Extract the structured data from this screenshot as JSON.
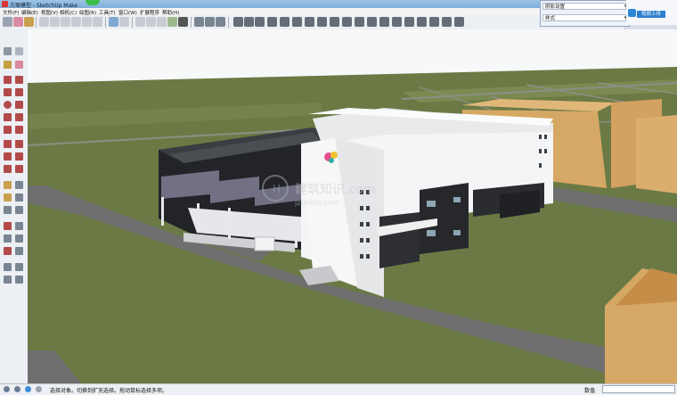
{
  "window": {
    "title": "方案模型 - SketchUp Make"
  },
  "menu": {
    "items": [
      "文件(F)",
      "编辑(E)",
      "视图(V)",
      "相机(C)",
      "绘图(R)",
      "工具(T)",
      "窗口(W)",
      "扩展程序",
      "帮助(H)"
    ]
  },
  "toolbar": {
    "items": [
      "select-tool",
      "eraser-tool",
      "paint-tool",
      "home-view",
      "iso-view",
      "top-view",
      "front-view",
      "right-view",
      "back-view",
      "left-view",
      "xray-style",
      "backedges-style",
      "wireframe-style",
      "hiddenline-style",
      "shaded-style",
      "textured-style",
      "monochrome-style",
      "section-plane",
      "display-sections",
      "section-cuts",
      "fog",
      "lightbulb",
      "camera-position",
      "look-around",
      "walk",
      "tape-measure",
      "protractor",
      "axes",
      "dimensions",
      "text",
      "3d-text",
      "shadows",
      "sandbox",
      "solid-tools",
      "components",
      "materials",
      "styles",
      "layers"
    ]
  },
  "tray": {
    "row1": "阴影设置",
    "row2": "样式"
  },
  "share": {
    "label": "视频上传"
  },
  "status": {
    "message": "选择对象。切换到扩充选择。拖动鼠标选择多项。",
    "measure_label": "数值",
    "measure_value": ""
  },
  "watermark": {
    "brand": "建筑知识.com",
    "sub": "jzzhishi.com"
  },
  "colors": {
    "grass": "#6b7a45",
    "grass_light": "#76864d",
    "road": "#6f6f6f",
    "sky": "#f7f8f9",
    "white_wall": "#f4f5f6",
    "dark_glass": "#222428",
    "tan": "#d6a865"
  }
}
